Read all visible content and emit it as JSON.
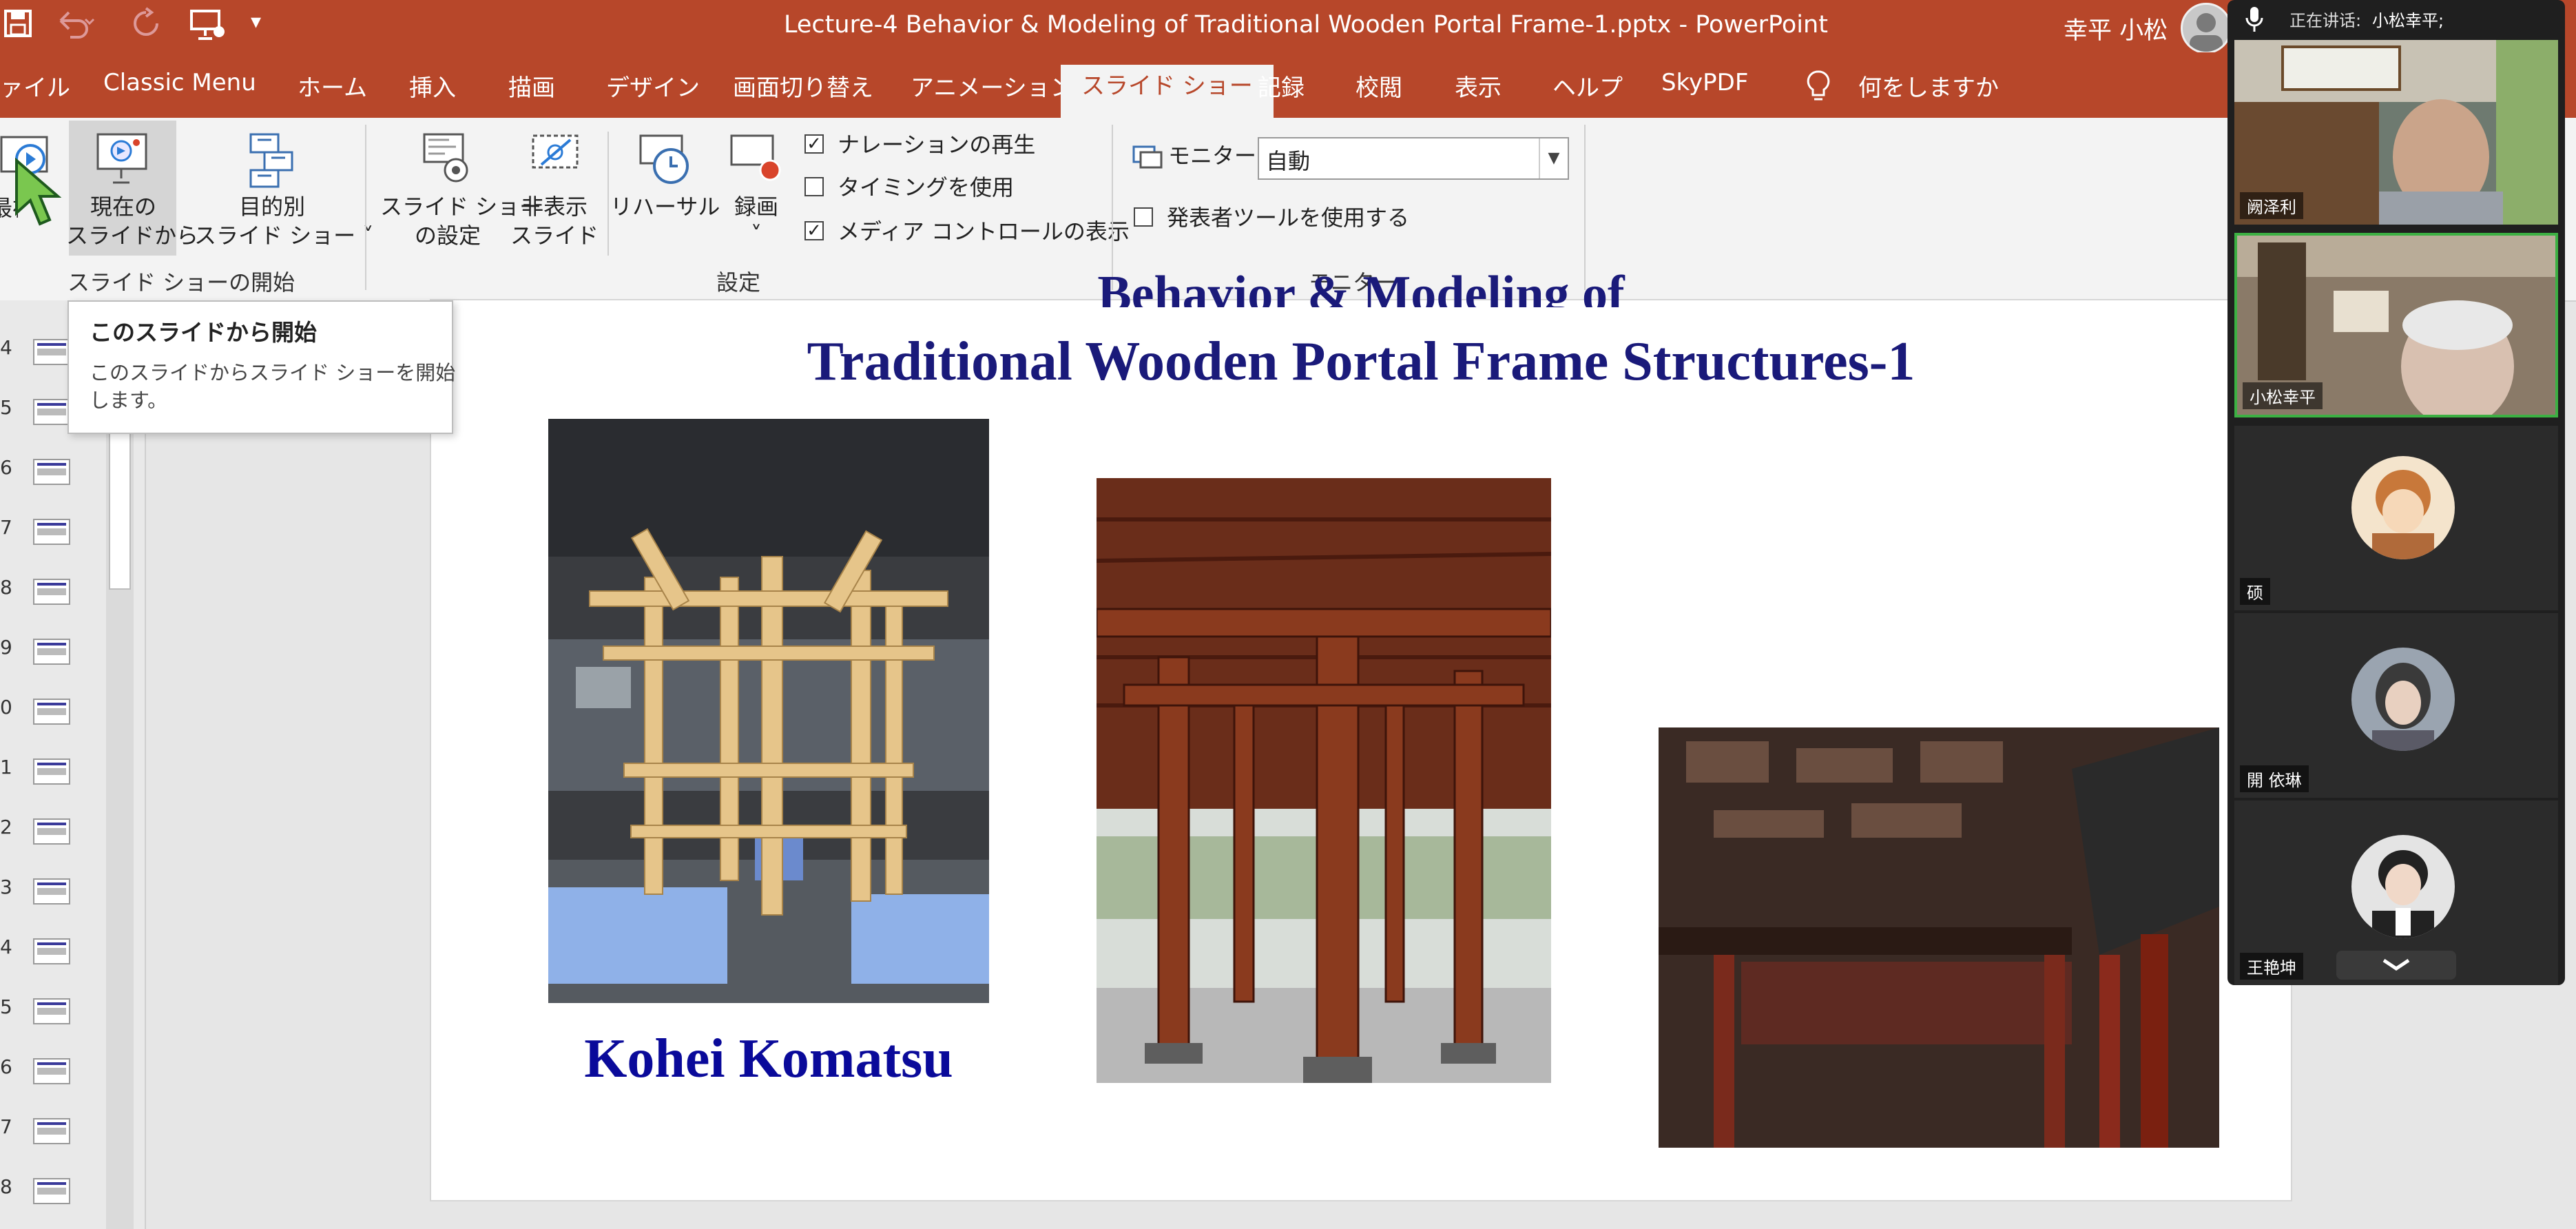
{
  "window": {
    "title": "Lecture-4 Behavior & Modeling of Traditional Wooden Portal Frame-1.pptx  -  PowerPoint",
    "user_name": "幸平 小松"
  },
  "tabs": [
    "ァイル",
    "Classic Menu",
    "ホーム",
    "挿入",
    "描画",
    "デザイン",
    "画面切り替え",
    "アニメーション",
    "スライド ショー",
    "記録",
    "校閲",
    "表示",
    "ヘルプ",
    "SkyPDF"
  ],
  "active_tab": "スライド ショー",
  "tellme": "何をしますか",
  "ribbon": {
    "start_group": {
      "label": "スライド ショーの開始",
      "btn_first_partial": "最初",
      "btn_current_line1": "現在の",
      "btn_current_line2": "スライドから",
      "btn_custom_line1": "目的別",
      "btn_custom_line2": "スライド ショー ˅"
    },
    "setup_group": {
      "label": "設定",
      "btn_setup_line1": "スライド ショー",
      "btn_setup_line2": "の設定",
      "btn_hide_line1": "非表示",
      "btn_hide_line2": "スライド",
      "btn_rehearse": "リハーサル",
      "btn_record": "録画",
      "btn_record_arrow": "˅",
      "cb_narration": "ナレーションの再生",
      "cb_timing": "タイミングを使用",
      "cb_media": "メディア コントロールの表示"
    },
    "monitor_group": {
      "label": "モニター",
      "monitor_label": "モニター:",
      "monitor_value": "自動",
      "cb_presenter": "発表者ツールを使用する"
    }
  },
  "checkboxes": {
    "narration": true,
    "timing": false,
    "media": true,
    "presenter": false
  },
  "tooltip": {
    "title": "このスライドから開始",
    "body_line1": "このスライドからスライド ショーを開始",
    "body_line2": "します。"
  },
  "slide_numbers": [
    "4",
    "5",
    "6",
    "7",
    "8",
    "9",
    "0",
    "1",
    "2",
    "3",
    "4",
    "5",
    "6",
    "7",
    "8"
  ],
  "slide": {
    "title_line1": "Behavior & Modeling of",
    "title_line2": "Traditional Wooden Portal Frame Structures-1",
    "author": "Kohei Komatsu"
  },
  "meeting": {
    "speaking_label": "正在讲话:",
    "speaker": "小松幸平;",
    "participants": [
      "阙泽利",
      "小松幸平",
      "硕",
      "開 依琳",
      "王艳坤"
    ]
  },
  "colors": {
    "accent": "#b7472a",
    "slide_title": "#1a1a7a",
    "author": "#0a0a9a",
    "active_speaker": "#3cb043"
  },
  "icons": {
    "save": "save-icon",
    "undo": "undo-icon",
    "redo": "redo-icon",
    "present": "present-icon",
    "lightbulb": "lightbulb-icon",
    "mic": "microphone-icon",
    "cursor": "mouse-cursor-icon"
  }
}
